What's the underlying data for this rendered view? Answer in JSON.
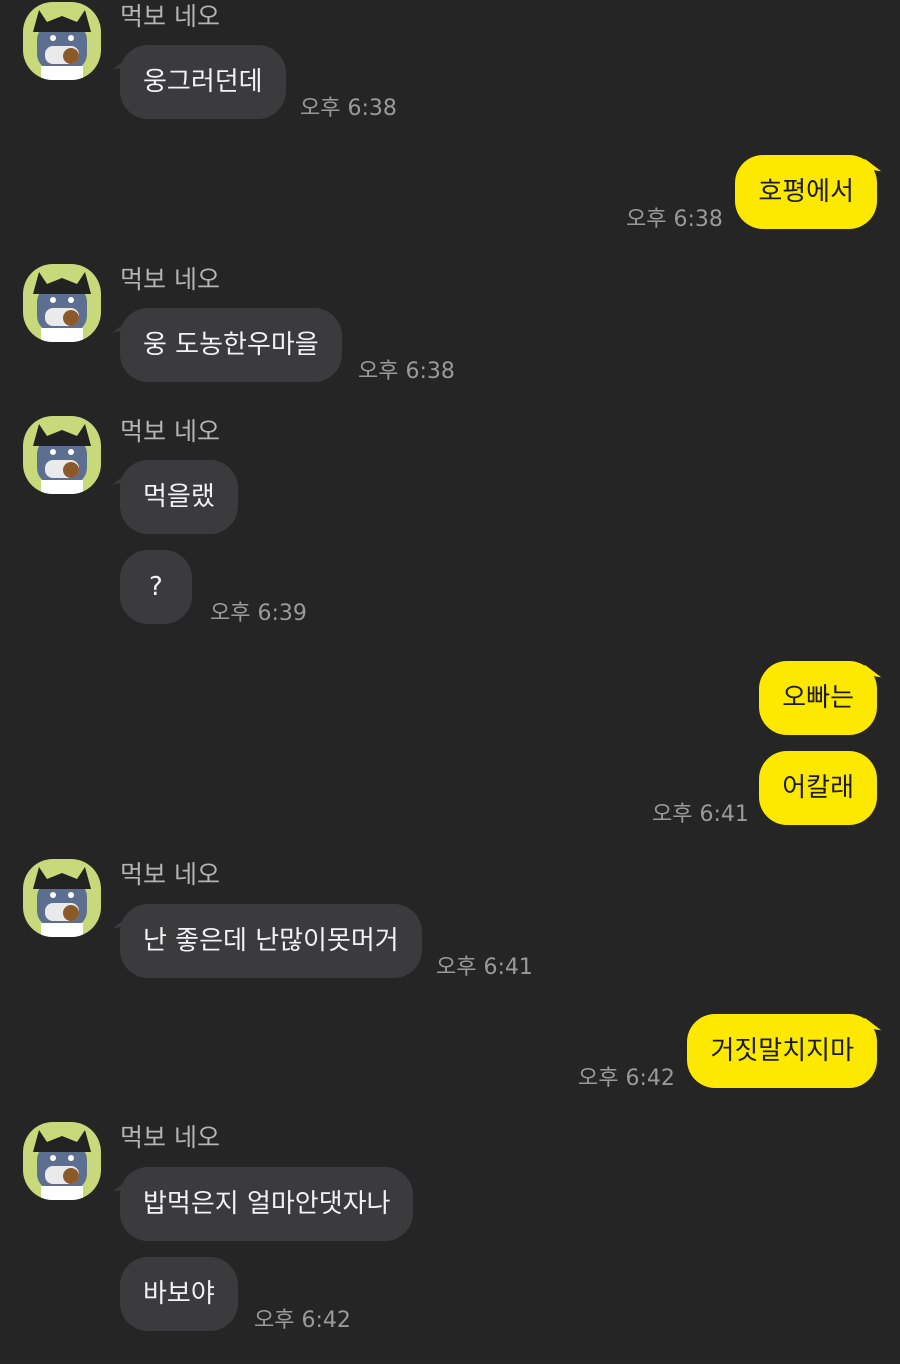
{
  "sender_name": "먹보 네오",
  "avatar_icon": "neo-cat-avatar-icon",
  "colors": {
    "background": "#252526",
    "incoming_bubble": "#3b3b3d",
    "outgoing_bubble": "#fde800",
    "avatar_bg": "#c7d97a"
  },
  "messages": [
    {
      "direction": "incoming",
      "text": "웅그러던데",
      "time": "오후 6:38"
    },
    {
      "direction": "outgoing",
      "text": "호평에서",
      "time": "오후 6:38"
    },
    {
      "direction": "incoming",
      "text": "웅 도농한우마을",
      "time": "오후 6:38"
    },
    {
      "direction": "incoming",
      "text": "먹을랬",
      "time": ""
    },
    {
      "direction": "incoming",
      "text": "?",
      "time": "오후 6:39"
    },
    {
      "direction": "outgoing",
      "text": "오빠는",
      "time": ""
    },
    {
      "direction": "outgoing",
      "text": "어칼래",
      "time": "오후 6:41"
    },
    {
      "direction": "incoming",
      "text": "난 좋은데 난많이못머거",
      "time": "오후 6:41"
    },
    {
      "direction": "outgoing",
      "text": "거짓말치지마",
      "time": "오후 6:42"
    },
    {
      "direction": "incoming",
      "text": "밥먹은지 얼마안댓자나",
      "time": ""
    },
    {
      "direction": "incoming",
      "text": "바보야",
      "time": "오후 6:42"
    }
  ]
}
